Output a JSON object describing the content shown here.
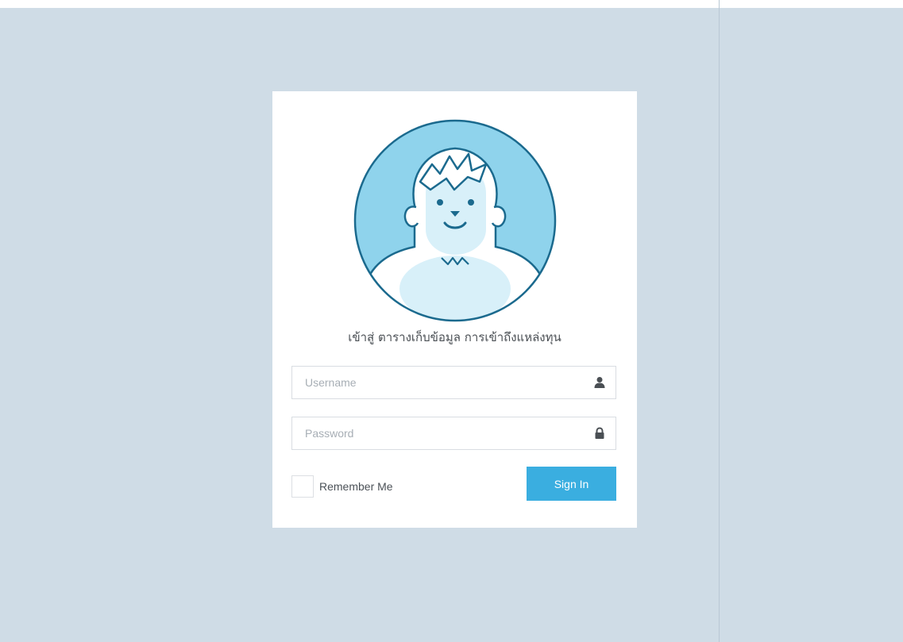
{
  "login": {
    "heading": "เข้าสู่ ตารางเก็บข้อมูล การเข้าถึงแหล่งทุน",
    "username": {
      "placeholder": "Username",
      "value": "",
      "icon": "user-icon"
    },
    "password": {
      "placeholder": "Password",
      "value": "",
      "icon": "lock-icon"
    },
    "remember_label": "Remember Me",
    "remember_checked": false,
    "signin_label": "Sign In"
  },
  "avatar": {
    "icon": "yeti-avatar-icon"
  },
  "colors": {
    "background": "#cfdce6",
    "accent": "#3aaee0",
    "avatar_fill": "#8fd3ec",
    "avatar_line": "#1b6a8e"
  }
}
